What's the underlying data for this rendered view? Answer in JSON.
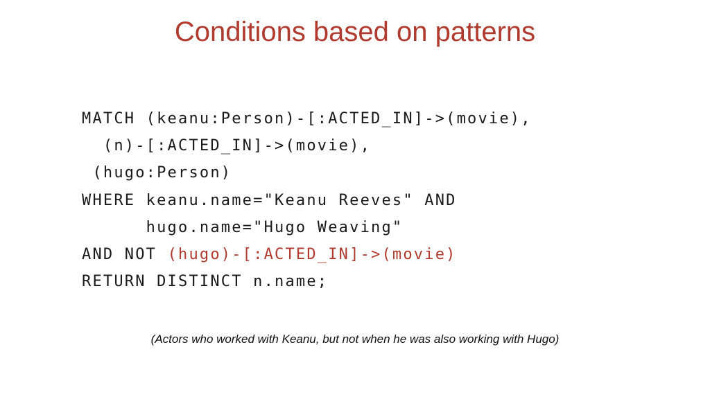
{
  "slide": {
    "title": "Conditions based on patterns",
    "code_lines": [
      {
        "text": "MATCH (keanu:Person)-[:ACTED_IN]->(movie),"
      },
      {
        "text": "  (n)-[:ACTED_IN]->(movie),"
      },
      {
        "text": " (hugo:Person)"
      },
      {
        "text": "WHERE keanu.name=\"Keanu Reeves\" AND"
      },
      {
        "text": "      hugo.name=\"Hugo Weaving\""
      },
      {
        "text": "AND NOT ",
        "highlight": "(hugo)-[:ACTED_IN]->(movie)"
      },
      {
        "text": "RETURN DISTINCT n.name;"
      }
    ],
    "caption": "(Actors who worked with Keanu, but not when he was also working with Hugo)",
    "colors": {
      "title": "#b03a2e",
      "highlight": "#b03a2e",
      "code_text": "#1a1a1a",
      "background": "#ffffff"
    }
  }
}
